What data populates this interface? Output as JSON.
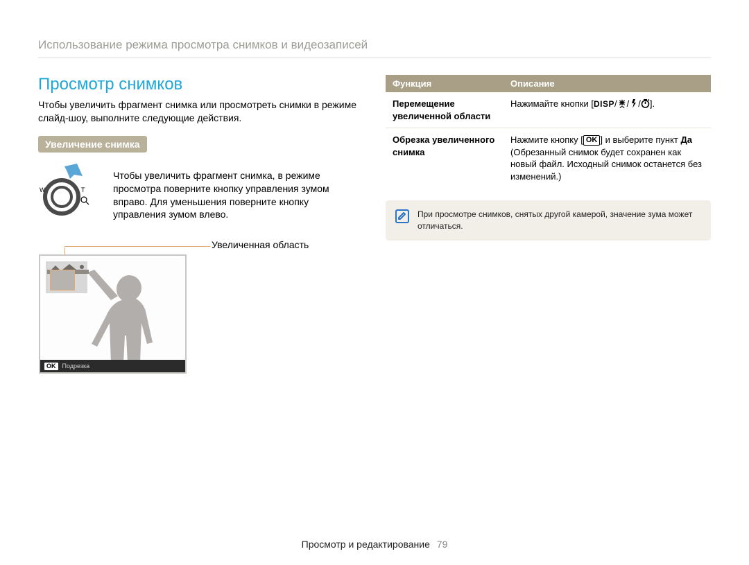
{
  "breadcrumb": "Использование режима просмотра снимков и видеозаписей",
  "section_title": "Просмотр снимков",
  "intro_text": "Чтобы увеличить фрагмент снимка или просмотреть снимки в режиме слайд-шоу, выполните следующие действия.",
  "subhead": "Увеличение снимка",
  "zoom_instruction": "Чтобы увеличить фрагмент снимка, в режиме просмотра поверните кнопку управления зумом вправо. Для уменьшения поверните кнопку управления зумом влево.",
  "zoom_labels": {
    "wide": "W",
    "tele": "T"
  },
  "magnified_area_label": "Увеличенная область",
  "preview": {
    "ok": "OK",
    "trim": "Подрезка"
  },
  "table": {
    "header_function": "Функция",
    "header_description": "Описание",
    "rows": [
      {
        "function": "Перемещение увеличенной области",
        "description_pre": "Нажимайте кнопки [",
        "disp": "DISP",
        "description_post": "].",
        "sep": "/"
      },
      {
        "function": "Обрезка увеличенного снимка",
        "desc_line1_pre": "Нажмите кнопку [",
        "ok": "OK",
        "desc_line1_post": "] и выберите пункт ",
        "da": "Да",
        "desc_line2": " (Обрезанный снимок будет сохранен как новый файл. Исходный снимок останется без изменений.)"
      }
    ]
  },
  "note_text": "При просмотре снимков, снятых другой камерой, значение зума может отличаться.",
  "footer": {
    "text": "Просмотр и редактирование",
    "page": "79"
  }
}
